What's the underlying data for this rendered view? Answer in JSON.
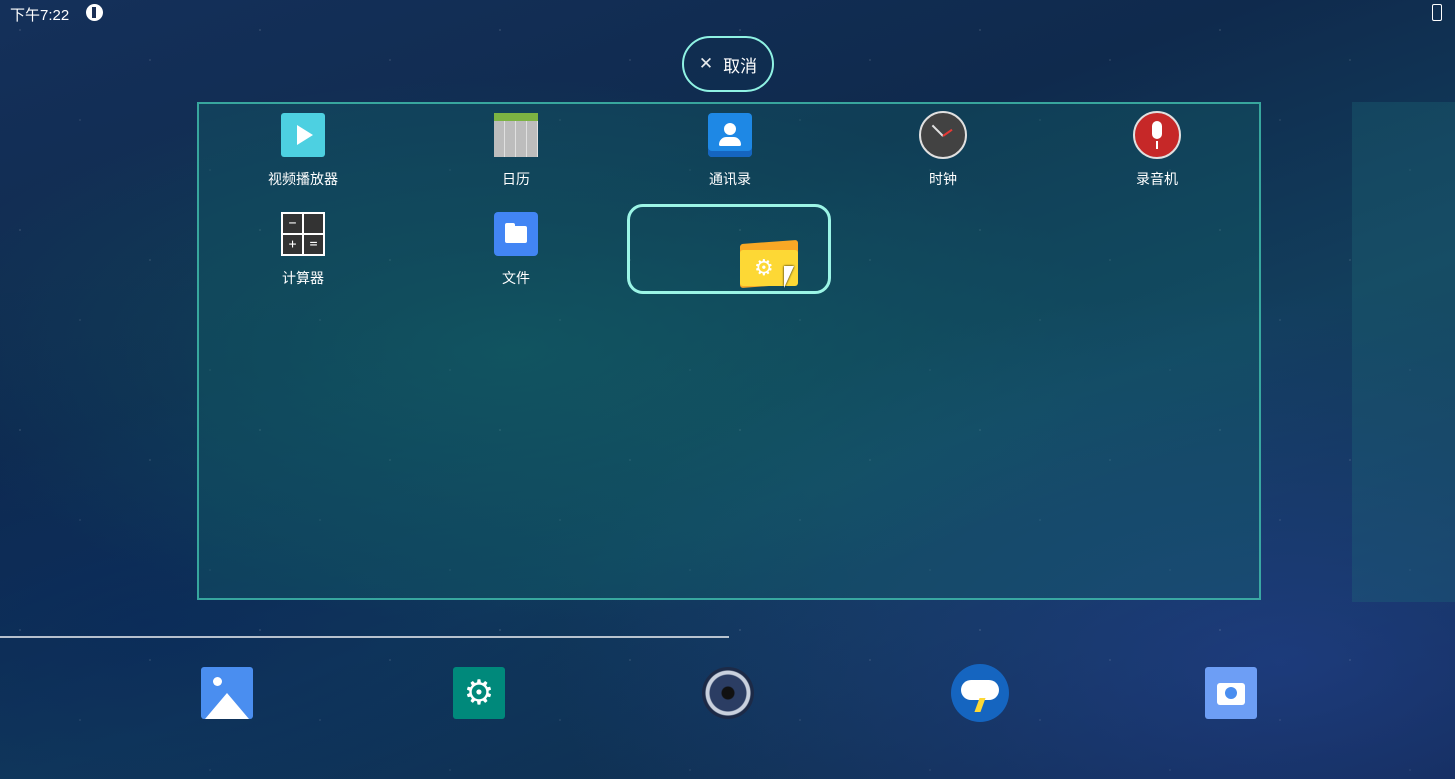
{
  "status_bar": {
    "time": "下午7:22",
    "notification_icon": "p-circle-icon",
    "battery_icon": "battery-icon"
  },
  "cancel_button": {
    "icon": "close-icon",
    "label": "取消"
  },
  "workspace": {
    "apps": [
      {
        "label": "视频播放器",
        "icon": "video-player-icon"
      },
      {
        "label": "日历",
        "icon": "calendar-icon"
      },
      {
        "label": "通讯录",
        "icon": "contacts-icon"
      },
      {
        "label": "时钟",
        "icon": "clock-icon"
      },
      {
        "label": "录音机",
        "icon": "recorder-icon"
      },
      {
        "label": "计算器",
        "icon": "calculator-icon"
      },
      {
        "label": "文件",
        "icon": "files-icon"
      }
    ],
    "dragging_icon": "settings-folder-icon"
  },
  "dock": {
    "items": [
      {
        "icon": "gallery-icon"
      },
      {
        "icon": "settings-icon"
      },
      {
        "icon": "music-icon"
      },
      {
        "icon": "weather-icon"
      },
      {
        "icon": "camera-icon"
      }
    ]
  },
  "colors": {
    "accent": "#9cf5e6",
    "workspace_border": "#46c8b4"
  }
}
